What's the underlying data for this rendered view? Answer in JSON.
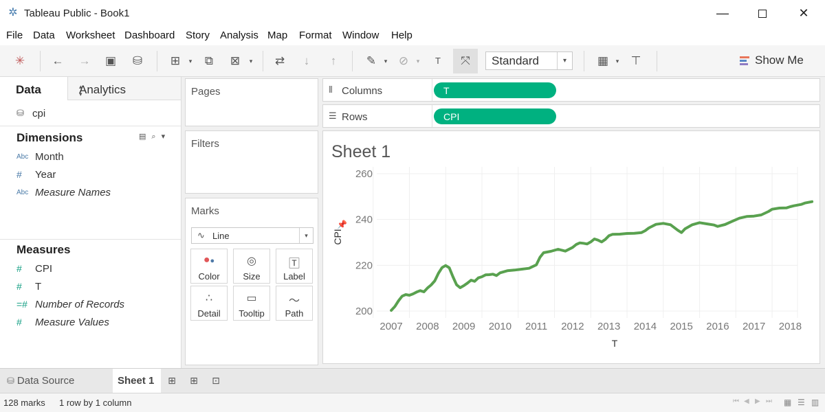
{
  "window": {
    "title": "Tableau Public - Book1",
    "min_glyph": "—",
    "close_glyph": "✕"
  },
  "menu": [
    "File",
    "Data",
    "Worksheet",
    "Dashboard",
    "Story",
    "Analysis",
    "Map",
    "Format",
    "Window",
    "Help"
  ],
  "toolbar": {
    "fit_value": "Standard",
    "show_me_label": "Show Me",
    "icons": [
      "tableau-logo-icon",
      "undo-icon",
      "redo-icon",
      "save-icon",
      "new-data-source-icon",
      "new-worksheet-icon",
      "duplicate-sheet-icon",
      "clear-sheet-icon",
      "swap-icon",
      "sort-ascending-icon",
      "sort-descending-icon",
      "highlight-icon",
      "group-icon",
      "show-mark-labels-icon",
      "fix-axes-icon",
      "fit-icon",
      "presentation-mode-icon"
    ],
    "show_me_colors": [
      "#e8765a",
      "#5a88c6",
      "#8e7cc3"
    ]
  },
  "data_pane": {
    "tab_data": "Data",
    "tab_analytics": "Analytics",
    "data_source": "cpi",
    "dimensions_header": "Dimensions",
    "dimensions": [
      {
        "type": "Abc",
        "name": "Month",
        "italic": false
      },
      {
        "type": "#",
        "name": "Year",
        "italic": false
      },
      {
        "type": "Abc",
        "name": "Measure Names",
        "italic": true
      }
    ],
    "measures_header": "Measures",
    "measures": [
      {
        "type": "#",
        "name": "CPI",
        "italic": false
      },
      {
        "type": "#",
        "name": "T",
        "italic": false
      },
      {
        "type": "=#",
        "name": "Number of Records",
        "italic": true
      },
      {
        "type": "#",
        "name": "Measure Values",
        "italic": true
      }
    ]
  },
  "cards": {
    "pages": "Pages",
    "filters": "Filters",
    "marks": "Marks",
    "mark_type": "Line",
    "mark_buttons": [
      {
        "label": "Color",
        "icon": "color-icon"
      },
      {
        "label": "Size",
        "icon": "size-icon"
      },
      {
        "label": "Label",
        "icon": "label-icon"
      },
      {
        "label": "Detail",
        "icon": "detail-icon"
      },
      {
        "label": "Tooltip",
        "icon": "tooltip-icon"
      },
      {
        "label": "Path",
        "icon": "path-icon"
      }
    ]
  },
  "shelves": {
    "columns_label": "Columns",
    "columns_pill": "T",
    "rows_label": "Rows",
    "rows_pill": "CPI",
    "pill_color": "#00b180"
  },
  "sheet": {
    "title": "Sheet 1"
  },
  "chart_data": {
    "type": "line",
    "xlabel": "T",
    "ylabel": "CPI",
    "xlim": [
      2006.6,
      2018.2
    ],
    "ylim": [
      197,
      263
    ],
    "x_ticks": [
      2007,
      2008,
      2009,
      2010,
      2011,
      2012,
      2013,
      2014,
      2015,
      2016,
      2017,
      2018
    ],
    "y_ticks": [
      200,
      220,
      240,
      260
    ],
    "grid": true,
    "line_color": "#59a14f",
    "series": [
      {
        "x": [
          2007.0,
          2007.1,
          2007.2,
          2007.3,
          2007.4,
          2007.5,
          2007.6,
          2007.7,
          2007.8,
          2007.9,
          2008.0,
          2008.1,
          2008.2,
          2008.3,
          2008.4,
          2008.5,
          2008.6,
          2008.7,
          2008.8,
          2008.9,
          2009.0,
          2009.1,
          2009.2,
          2009.3,
          2009.4,
          2009.5,
          2009.6,
          2009.7,
          2009.8,
          2009.9,
          2010.0,
          2010.2,
          2010.4,
          2010.6,
          2010.8,
          2011.0,
          2011.1,
          2011.2,
          2011.3,
          2011.4,
          2011.6,
          2011.8,
          2012.0,
          2012.1,
          2012.2,
          2012.3,
          2012.4,
          2012.5,
          2012.6,
          2012.7,
          2012.8,
          2012.9,
          2013.0,
          2013.1,
          2013.3,
          2013.5,
          2013.7,
          2013.9,
          2014.0,
          2014.1,
          2014.3,
          2014.5,
          2014.7,
          2014.9,
          2015.0,
          2015.1,
          2015.2,
          2015.3,
          2015.5,
          2015.7,
          2015.9,
          2016.0,
          2016.2,
          2016.4,
          2016.6,
          2016.8,
          2017.0,
          2017.2,
          2017.4,
          2017.5,
          2017.7,
          2017.9,
          2018.0,
          2018.1,
          2018.2,
          2018.3,
          2018.4,
          2018.5,
          2018.6
        ],
        "y": [
          200.3,
          202.0,
          204.5,
          206.5,
          207.2,
          206.9,
          207.5,
          208.3,
          208.9,
          208.4,
          210.1,
          211.4,
          213.2,
          216.5,
          219.0,
          219.9,
          218.9,
          215.0,
          211.5,
          210.2,
          211.1,
          212.2,
          213.5,
          213.0,
          214.5,
          215.0,
          215.8,
          215.9,
          216.1,
          215.5,
          216.7,
          217.6,
          217.9,
          218.3,
          218.7,
          220.2,
          223.5,
          225.5,
          225.8,
          226.1,
          227.0,
          226.2,
          227.8,
          229.1,
          229.8,
          229.6,
          229.3,
          230.2,
          231.5,
          231.0,
          230.2,
          231.3,
          232.9,
          233.5,
          233.6,
          233.9,
          234.0,
          234.3,
          235.1,
          236.3,
          237.9,
          238.3,
          237.7,
          235.3,
          234.3,
          235.9,
          236.8,
          237.7,
          238.6,
          238.1,
          237.6,
          237.0,
          237.8,
          239.2,
          240.6,
          241.3,
          241.5,
          242.0,
          243.5,
          244.5,
          245.0,
          245.1,
          245.6,
          246.0,
          246.3,
          246.6,
          247.2,
          247.5,
          247.8
        ]
      }
    ]
  },
  "tabs": {
    "data_source": "Data Source",
    "sheet": "Sheet 1"
  },
  "status": {
    "marks": "128 marks",
    "dims": "1 row by 1 column"
  }
}
